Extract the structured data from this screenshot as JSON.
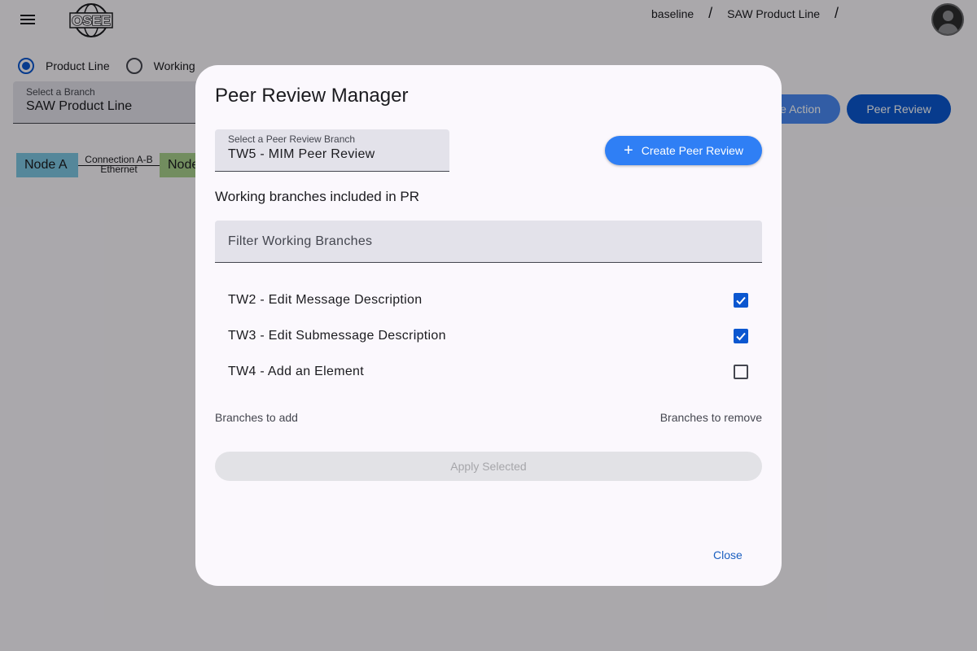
{
  "header": {
    "breadcrumbs": [
      "baseline",
      "SAW Product Line"
    ],
    "separator": "/"
  },
  "view_mode": {
    "options": [
      {
        "label": "Product Line",
        "selected": true
      },
      {
        "label": "Working",
        "selected": false
      }
    ]
  },
  "branch_select": {
    "label": "Select a Branch",
    "value": "SAW Product Line"
  },
  "toolbar": {
    "action_label": "e Action",
    "peer_review_label": "Peer Review"
  },
  "diagram": {
    "node_a": "Node A",
    "node_b": "Node",
    "connection_name": "Connection A-B",
    "connection_type": "Ethernet"
  },
  "dialog": {
    "title": "Peer Review Manager",
    "pr_branch_label": "Select a Peer Review Branch",
    "pr_branch_value": "TW5 - MIM Peer Review",
    "create_button": "Create Peer Review",
    "subheading": "Working branches included in PR",
    "filter_placeholder": "Filter Working Branches",
    "branches": [
      {
        "name": "TW2 - Edit Message Description",
        "checked": true
      },
      {
        "name": "TW3 - Edit Submessage Description",
        "checked": true
      },
      {
        "name": "TW4 - Add an Element",
        "checked": false
      }
    ],
    "branches_to_add": "Branches to add",
    "branches_to_remove": "Branches to remove",
    "apply_button": "Apply Selected",
    "close_button": "Close"
  },
  "colors": {
    "primary": "#0b57d0",
    "accent": "#2f7ff5",
    "node_a": "#7ec8e3",
    "node_b": "#a8d08d"
  }
}
